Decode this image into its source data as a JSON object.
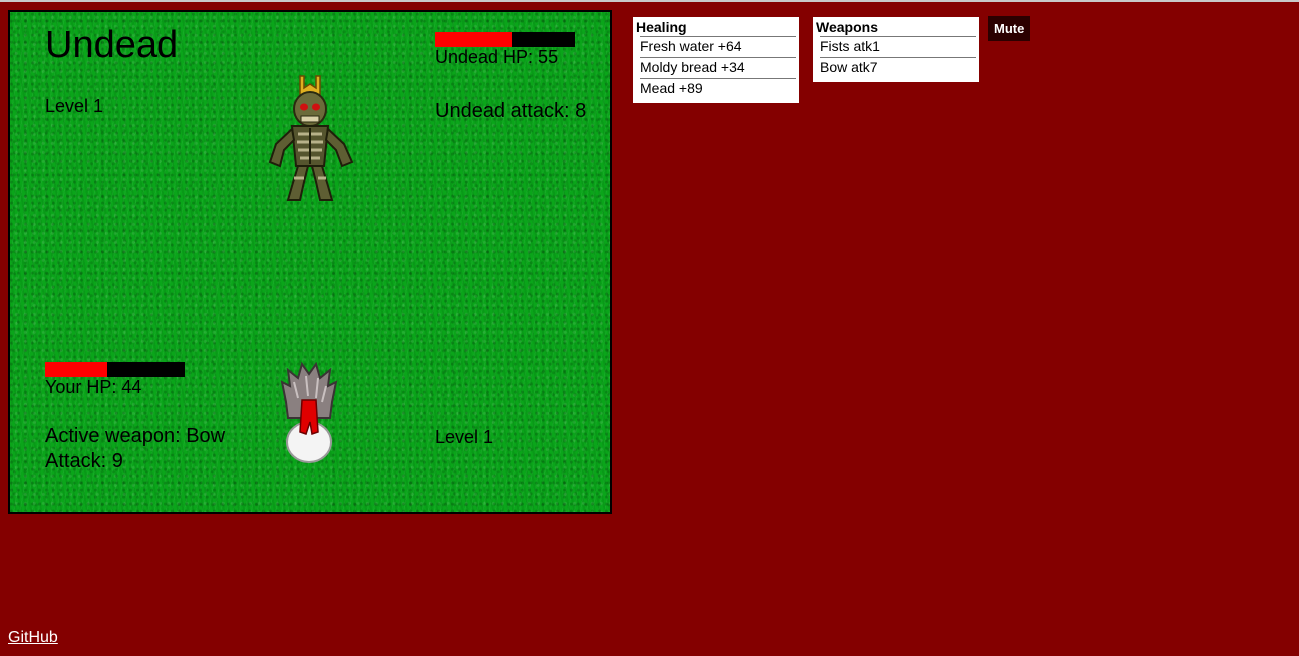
{
  "enemy": {
    "name": "Undead",
    "level_text": "Level 1",
    "hp_text": "Undead HP: 55",
    "hp_fraction": 0.55,
    "attack_text": "Undead attack: 8"
  },
  "player": {
    "hp_text": "Your HP: 44",
    "hp_fraction": 0.44,
    "weapon_text": "Active weapon: Bow",
    "attack_text": "Attack: 9",
    "level_text": "Level 1"
  },
  "healing": {
    "title": "Healing",
    "items": [
      "Fresh water +64",
      "Moldy bread +34",
      "Mead +89"
    ]
  },
  "weapons": {
    "title": "Weapons",
    "items": [
      "Fists atk1",
      "Bow atk7"
    ]
  },
  "controls": {
    "mute_label": "Mute"
  },
  "footer": {
    "github_label": "GitHub"
  },
  "colors": {
    "background": "#840000",
    "grass": "#0aa51a",
    "hp_fill": "#ff0000",
    "hp_empty": "#000000"
  }
}
